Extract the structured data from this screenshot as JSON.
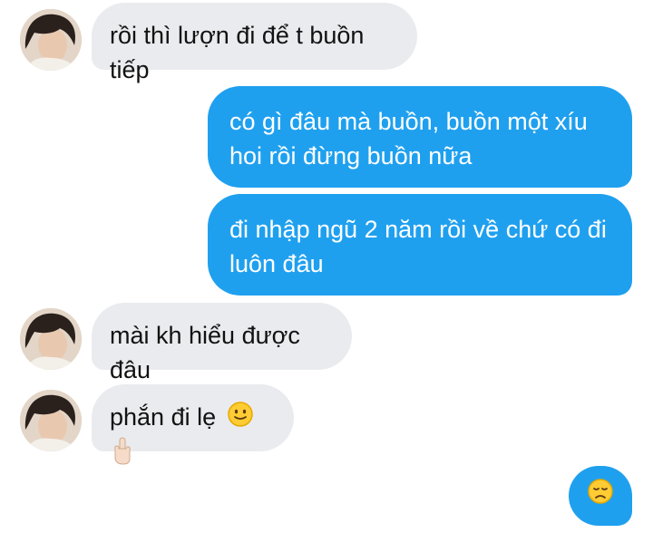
{
  "conversation": {
    "messages": [
      {
        "sender": "contact",
        "text": "rồi thì lượn đi để t buồn tiếp"
      },
      {
        "sender": "me",
        "text": "có gì đâu mà buồn, buồn một xíu hoi rồi đừng buồn nữa"
      },
      {
        "sender": "me",
        "text": "đi nhập ngũ 2 năm rồi về chứ có đi luôn đâu"
      },
      {
        "sender": "contact",
        "text": "mài kh hiểu được đâu"
      },
      {
        "sender": "contact",
        "text": "phắn đi lẹ",
        "emojis": [
          "slightly-smiling-face",
          "middle-finger-light-skin"
        ]
      },
      {
        "sender": "me",
        "emoji": "disappointed-face"
      }
    ]
  },
  "colors": {
    "incoming_bubble": "#e9ebee",
    "outgoing_bubble": "#1fa0ef",
    "incoming_text": "#121212",
    "outgoing_text": "#ffffff"
  }
}
